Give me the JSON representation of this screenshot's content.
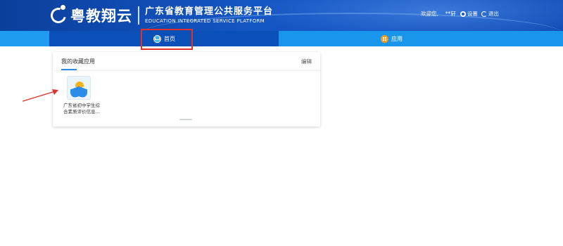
{
  "header": {
    "brand": "粤教翔云",
    "subtitle_cn": "广东省教育管理公共服务平台",
    "subtitle_en": "EDUCATION INTEGRATED SERVICE PLATFORM",
    "greeting": "欢迎您,",
    "username": "**轩",
    "settings_label": "设置",
    "logout_label": "退出"
  },
  "nav": {
    "home_label": "首页",
    "apps_label": "应用"
  },
  "favorites": {
    "title": "我的收藏应用",
    "edit_label": "编辑",
    "apps": [
      {
        "name": "广东省初中学生综合素质评价信息..."
      }
    ]
  },
  "colors": {
    "header_blue": "#1456c4",
    "nav_active": "#0b4fb8",
    "nav_blue": "#1a95ec",
    "annotation_red": "#e0312b",
    "accent": "#2a8ce6"
  },
  "icons": [
    "logo-icon",
    "settings-gear-icon",
    "logout-icon",
    "home-tab-icon",
    "apps-grid-icon",
    "app-care-icon"
  ]
}
